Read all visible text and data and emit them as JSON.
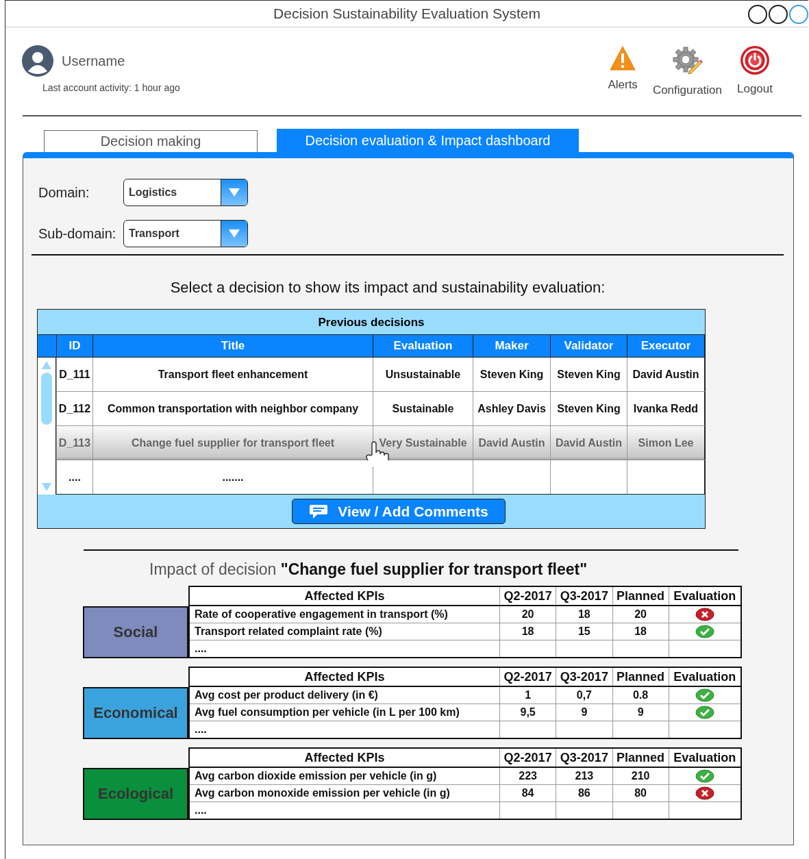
{
  "window": {
    "title": "Decision Sustainability Evaluation System"
  },
  "user": {
    "name": "Username",
    "activity": "Last account activity: 1 hour ago"
  },
  "actions": [
    {
      "kind": "alerts",
      "label": "Alerts"
    },
    {
      "kind": "configuration",
      "label": "Configuration"
    },
    {
      "kind": "logout",
      "label": "Logout"
    }
  ],
  "tabs": [
    {
      "label": "Decision making",
      "selected": false
    },
    {
      "label": "Decision evaluation & Impact dashboard",
      "selected": true
    }
  ],
  "filters": [
    {
      "label": "Domain:",
      "value": "Logistics"
    },
    {
      "label": "Sub-domain:",
      "value": "Transport"
    }
  ],
  "prompt": "Select a decision to show its impact and sustainability evaluation:",
  "decisions": {
    "title": "Previous decisions",
    "columns": [
      "ID",
      "Title",
      "Evaluation",
      "Maker",
      "Validator",
      "Executor"
    ],
    "rows": [
      {
        "cells": [
          "D_111",
          "Transport fleet enhancement",
          "Unsustainable",
          "Steven King",
          "Steven King",
          "David Austin"
        ],
        "selected": false
      },
      {
        "cells": [
          "D_112",
          "Common transportation with neighbor company",
          "Sustainable",
          "Ashley Davis",
          "Steven King",
          "Ivanka Redd"
        ],
        "selected": false
      },
      {
        "cells": [
          "D_113",
          "Change fuel supplier for transport fleet",
          "Very Sustainable",
          "David Austin",
          "David Austin",
          "Simon Lee"
        ],
        "selected": true
      },
      {
        "cells": [
          "....",
          "......."
        ],
        "selected": false
      }
    ],
    "button": "View / Add Comments"
  },
  "impact": {
    "heading": "Impact of decision **\"Change fuel supplier for transport fleet\"**",
    "groups": [
      {
        "category": "Social",
        "color": "#7f8bbd",
        "columns": [
          "Affected KPIs",
          "Q2-2017",
          "Q3-2017",
          "Planned",
          "Evaluation"
        ],
        "rows": [
          {
            "kpi": "Rate of cooperative engagement in transport (%)",
            "q2": "20",
            "q3": "18",
            "planned": "20",
            "met": false
          },
          {
            "kpi": "Transport related complaint rate (%)",
            "q2": "18",
            "q3": "15",
            "planned": "18",
            "met": true
          }
        ],
        "more": "...."
      },
      {
        "category": "Economical",
        "color": "#3aa3dd",
        "columns": [
          "Affected KPIs",
          "Q2-2017",
          "Q3-2017",
          "Planned",
          "Evaluation"
        ],
        "rows": [
          {
            "kpi": "Avg cost per product delivery (in €)",
            "q2": "1",
            "q3": "0,7",
            "planned": "0.8",
            "met": true
          },
          {
            "kpi": "Avg fuel consumption per vehicle (in L per 100 km)",
            "q2": "9,5",
            "q3": "9",
            "planned": "9",
            "met": true
          }
        ],
        "more": "...."
      },
      {
        "category": "Ecological",
        "color": "#0a8f3c",
        "columns": [
          "Affected KPIs",
          "Q2-2017",
          "Q3-2017",
          "Planned",
          "Evaluation"
        ],
        "rows": [
          {
            "kpi": "Avg carbon dioxide emission per vehicle (in g)",
            "q2": "223",
            "q3": "213",
            "planned": "210",
            "met": true
          },
          {
            "kpi": "Avg carbon monoxide emission per vehicle (in g)",
            "q2": "84",
            "q3": "86",
            "planned": "80",
            "met": false
          }
        ],
        "more": "...."
      }
    ]
  }
}
